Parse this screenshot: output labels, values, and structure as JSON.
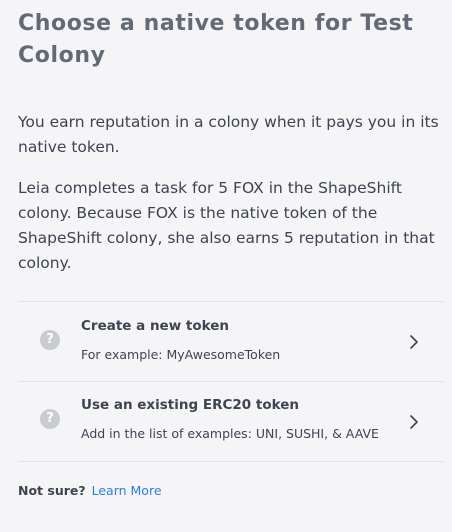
{
  "header": {
    "title": "Choose a native token for Test Colony"
  },
  "intro": {
    "paragraph_1": "You earn reputation in a colony when it pays you in its native token.",
    "paragraph_2": "Leia completes a task for 5 FOX in the ShapeShift colony. Because FOX is the native token of the ShapeShift colony, she also earns 5 reputation in that colony."
  },
  "options": [
    {
      "icon": "question-icon",
      "title": "Create a new token",
      "subtitle": "For example: MyAwesomeToken"
    },
    {
      "icon": "question-icon",
      "title": "Use an existing ERC20 token",
      "subtitle": "Add in the list of examples: UNI, SUSHI, & AAVE"
    }
  ],
  "footer": {
    "prompt": "Not sure?",
    "link": "Learn More"
  },
  "colors": {
    "background": "#f5f5f8",
    "title": "#636a75",
    "text": "#3d4450",
    "link": "#2d7ed9",
    "divider": "#e2e3e8",
    "icon": "#c8cbd0"
  }
}
